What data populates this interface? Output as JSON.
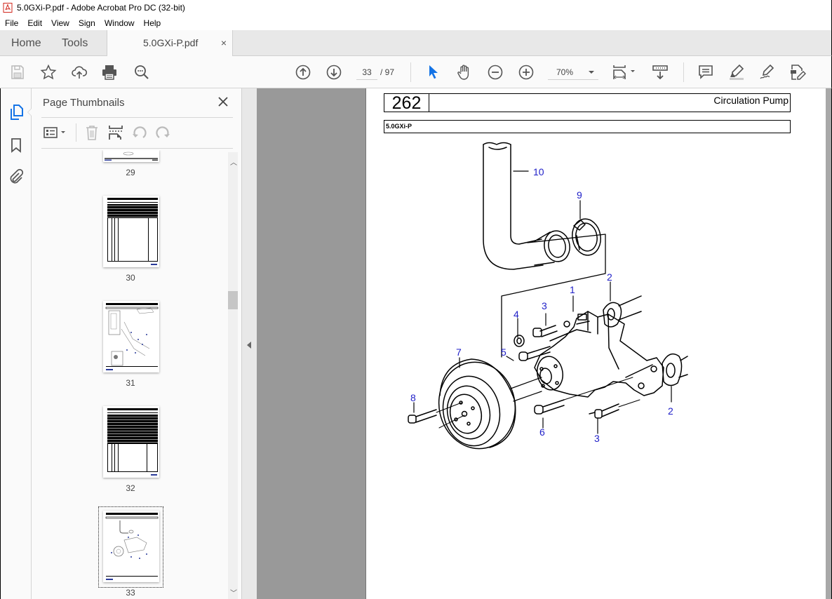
{
  "window": {
    "title": "5.0GXi-P.pdf - Adobe Acrobat Pro DC (32-bit)",
    "app_icon": "acrobat-pdf-icon"
  },
  "menu": {
    "items": [
      "File",
      "Edit",
      "View",
      "Sign",
      "Window",
      "Help"
    ]
  },
  "tabs": {
    "home": "Home",
    "tools": "Tools",
    "document": "5.0GXi-P.pdf",
    "close_glyph": "×"
  },
  "toolbar": {
    "left_icons": [
      "save-icon",
      "bookmark-star-icon",
      "cloud-upload-icon",
      "print-icon",
      "search-zoom-icon"
    ],
    "page_current": "33",
    "page_total": "/ 97",
    "zoom_value": "70%",
    "nav_icons": [
      "previous-page-icon",
      "next-page-icon",
      "select-cursor-icon",
      "hand-tool-icon",
      "zoom-out-icon",
      "zoom-in-icon"
    ],
    "right_icons": [
      "page-fit-icon",
      "scroll-mode-icon",
      "comment-icon",
      "highlight-icon",
      "sign-pen-icon",
      "edit-pdf-icon"
    ],
    "accent_color": "#1473e6"
  },
  "left_rail": {
    "items": [
      "page-thumbnails-icon",
      "bookmarks-icon",
      "attachments-icon"
    ],
    "active": "page-thumbnails-icon"
  },
  "thumbnails_panel": {
    "title": "Page Thumbnails",
    "close_glyph": "✕",
    "tools": [
      "thumbnail-options-icon",
      "delete-page-icon",
      "insert-page-icon",
      "rotate-left-icon",
      "rotate-right-icon"
    ],
    "pages": [
      {
        "label": "29",
        "kind": "drawing-partial"
      },
      {
        "label": "30",
        "kind": "table"
      },
      {
        "label": "31",
        "kind": "drawing"
      },
      {
        "label": "32",
        "kind": "table"
      },
      {
        "label": "33",
        "kind": "drawing",
        "selected": true
      }
    ]
  },
  "document": {
    "page_number": "262",
    "section_title": "Circulation Pump",
    "model": "5.0GXi-P",
    "callouts": [
      "10",
      "9",
      "2",
      "1",
      "3",
      "4",
      "5",
      "7",
      "8",
      "6",
      "2",
      "3"
    ],
    "callout_color": "#1e1ec8"
  }
}
